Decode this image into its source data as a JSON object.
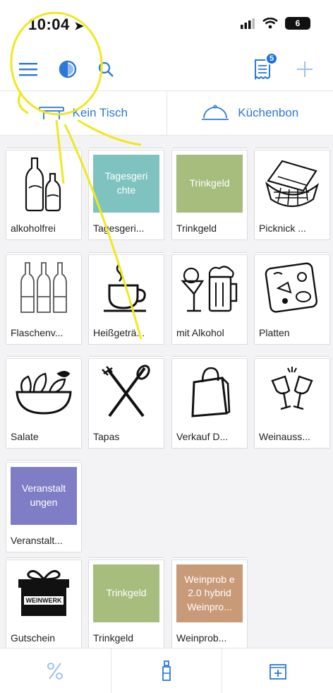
{
  "status": {
    "time": "10:04",
    "battery": "6"
  },
  "toolbar": {
    "badge_count": "5"
  },
  "actions": {
    "table_label": "Kein Tisch",
    "kitchen_label": "Küchenbon"
  },
  "colors": {
    "accent": "#2c78d8",
    "badge": "#1e6fe0",
    "teal": "#7fc3c0",
    "green": "#a6bd7e",
    "purple": "#7f7dc6",
    "brown": "#c89a78",
    "scribble": "#f0e81e"
  },
  "tiles": [
    {
      "label": "alkoholfrei",
      "icon": "bottles-icon"
    },
    {
      "label": "Tagesgeri...",
      "color_text": "Tagesgeri chte",
      "color": "teal"
    },
    {
      "label": "Trinkgeld",
      "color_text": "Trinkgeld",
      "color": "green"
    },
    {
      "label": "Picknick ...",
      "icon": "picnic-basket-icon"
    },
    {
      "label": "Flaschenv...",
      "icon": "wine-bottles-icon"
    },
    {
      "label": "Heißgeträ...",
      "icon": "coffee-cup-icon"
    },
    {
      "label": "mit Alkohol",
      "icon": "cocktail-beer-icon"
    },
    {
      "label": "Platten",
      "icon": "platter-icon"
    },
    {
      "label": "Salate",
      "icon": "salad-bowl-icon"
    },
    {
      "label": "Tapas",
      "icon": "fork-knife-icon"
    },
    {
      "label": "Verkauf D...",
      "icon": "shopping-bag-icon"
    },
    {
      "label": "Weinauss...",
      "icon": "wine-glasses-icon"
    },
    {
      "label": "Veranstalt...",
      "color_text": "Veranstalt ungen",
      "color": "purple"
    },
    {
      "label": "Gutschein",
      "icon": "gift-icon",
      "gift_text": "WEINWERK"
    },
    {
      "label": "Trinkgeld",
      "color_text": "Trinkgeld",
      "color": "green"
    },
    {
      "label": "Weinprob...",
      "color_text": "Weinprob e 2.0 hybrid Weinpro...",
      "color": "brown"
    }
  ]
}
